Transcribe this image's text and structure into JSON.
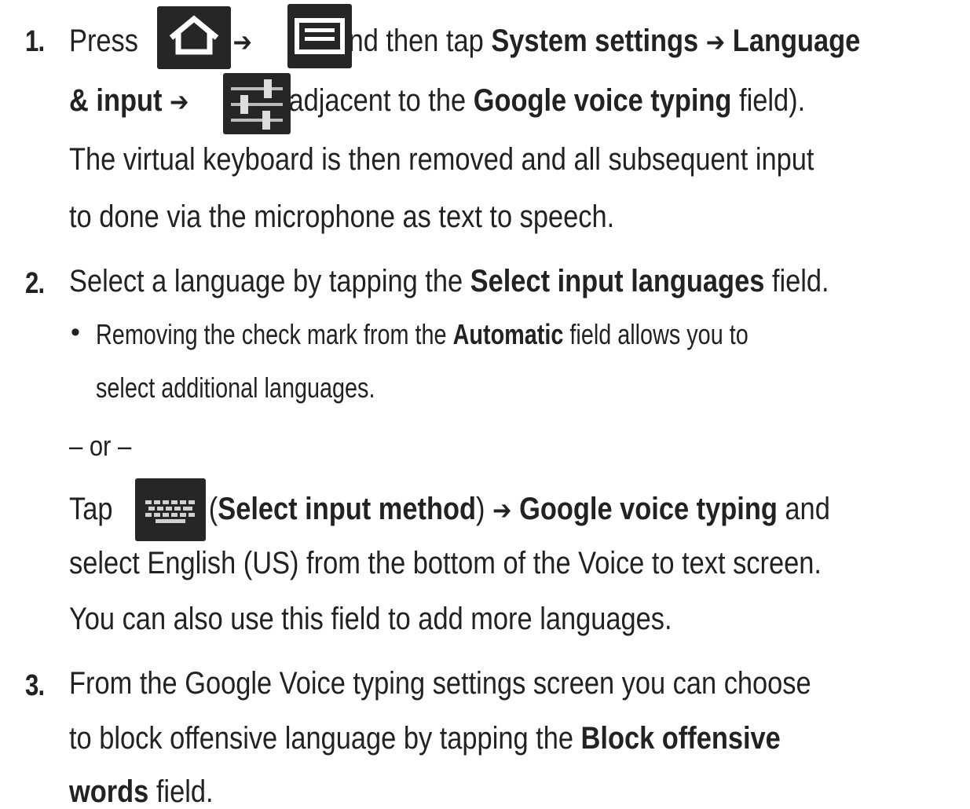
{
  "step1": {
    "number": "1.",
    "line1": {
      "press": "Press",
      "arrow1": "➔",
      "mid": "and then tap",
      "system_settings": "System settings",
      "arrow2": "➔",
      "language": "Language"
    },
    "line2": {
      "and_input": "& input",
      "arrow": "➔",
      "open_paren": "(adjacent to the",
      "google_voice_typing": "Google voice typing",
      "close": "field)."
    },
    "line3": "The virtual keyboard is then removed and all subsequent input",
    "line4": "to done via the microphone as text to speech."
  },
  "step2": {
    "number": "2.",
    "line1": {
      "pre": "Select a language by tapping the",
      "select_input_languages": "Select input languages",
      "post": "field."
    },
    "bullet": {
      "dot": "•",
      "pre": "Removing the check mark from the",
      "automatic": "Automatic",
      "post": "field allows you to",
      "line2": "select additional languages."
    },
    "or": "– or –",
    "tap_line": {
      "tap": "Tap",
      "open": "(",
      "select_input_method": "Select input method",
      "close": ")",
      "arrow": "➔",
      "google_voice_typing": "Google voice typing",
      "and": "and"
    },
    "line_select": "select English (US) from the bottom of the Voice to text screen.",
    "line_also": "You can also use this field to add more languages."
  },
  "step3": {
    "number": "3.",
    "line1": "From the Google Voice typing settings screen you can choose",
    "line2": {
      "pre": "to block offensive language by tapping the",
      "block_offensive": "Block offensive"
    },
    "line3": {
      "words": "words",
      "post": "field."
    }
  },
  "icons": {
    "home": "home-icon",
    "menu": "menu-icon",
    "settings_sliders": "settings-sliders-icon",
    "keyboard": "keyboard-icon"
  },
  "colors": {
    "text": "#222222",
    "icon_bg": "#262626",
    "icon_fg": "#ffffff",
    "heading_blue": "#1f5fbf"
  }
}
